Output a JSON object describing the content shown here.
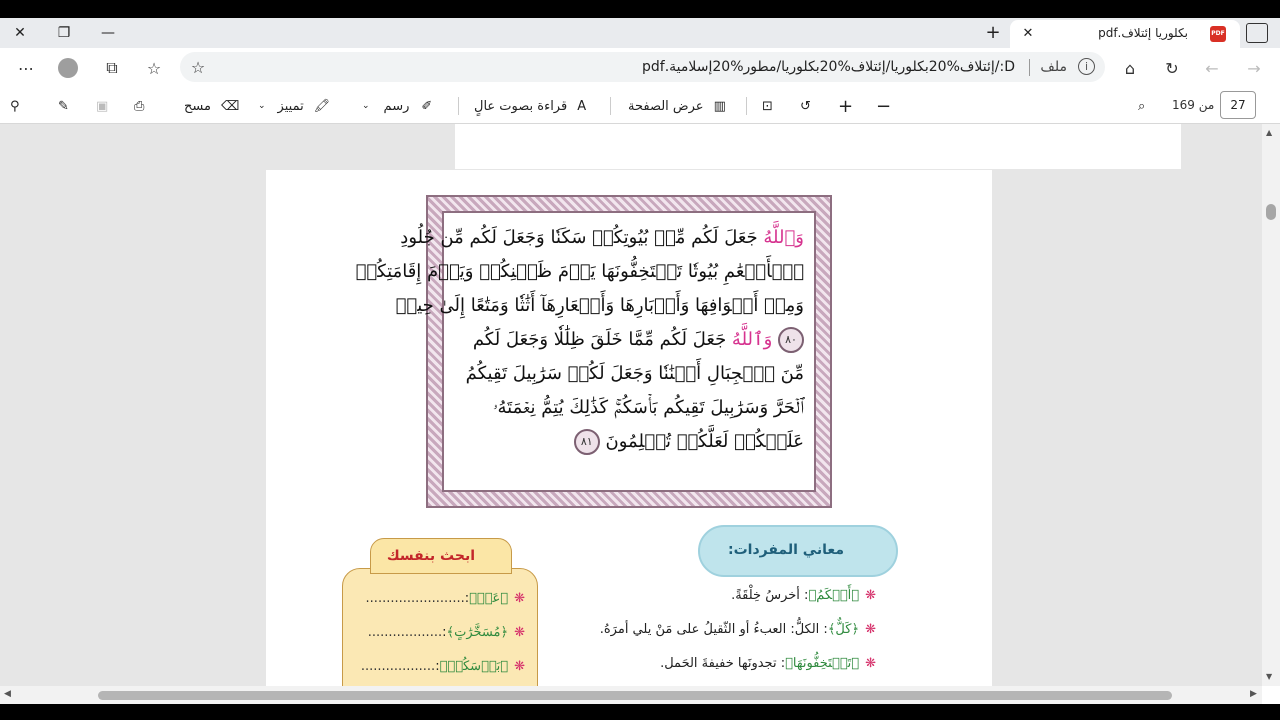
{
  "browser": {
    "tab_title": "بكلوريا إئتلاف.pdf",
    "tab_icon_label": "PDF",
    "window_close": "✕",
    "window_restore": "❐",
    "window_minimize": "—",
    "new_tab": "+",
    "tab_close": "✕"
  },
  "addressbar": {
    "file_label": "ملف",
    "url": "D:/إئتلاف%20بكلوريا/إئتلاف%20بكلوريا/مطور%20إسلامية.pdf",
    "info_glyph": "i"
  },
  "pdf_toolbar": {
    "page_number": "27",
    "page_of": "من 169",
    "page_view": "عرض الصفحة",
    "read_aloud": "قراءة بصوت عالٍ",
    "draw": "رسم",
    "highlight": "تمييز",
    "erase": "مسح"
  },
  "quran": {
    "lines": [
      {
        "pre": "",
        "divine": "وَٱللَّهُ",
        "text": " جَعَلَ لَكُم مِّنۢ بُيُوتِكُمۡ سَكَنٗا وَجَعَلَ لَكُم مِّن جُلُودِ"
      },
      {
        "pre": "",
        "divine": "",
        "text": "ٱلۡأَنۡعَٰمِ بُيُوتٗا تَسۡتَخِفُّونَهَا يَوۡمَ ظَعۡنِكُمۡ وَيَوۡمَ إِقَامَتِكُمۡ"
      },
      {
        "pre": "",
        "divine": "",
        "text": "وَمِنۡ أَصۡوَافِهَا وَأَوۡبَارِهَا وَأَشۡعَارِهَآ أَثَٰثٗا وَمَتَٰعًا إِلَىٰ حِينٖ"
      },
      {
        "pre": "٨٠",
        "divine": "وَٱللَّهُ",
        "text": " جَعَلَ لَكُم مِّمَّا خَلَقَ ظِلَٰلٗا وَجَعَلَ لَكُم"
      },
      {
        "pre": "",
        "divine": "",
        "text": "مِّنَ ٱلۡجِبَالِ أَكۡنَٰنٗا وَجَعَلَ لَكُمۡ سَرَٰبِيلَ تَقِيكُمُ"
      },
      {
        "pre": "",
        "divine": "",
        "text": "ٱلۡحَرَّ وَسَرَٰبِيلَ تَقِيكُم بَأۡسَكُمۡۚ كَذَٰلِكَ يُتِمُّ نِعۡمَتَهُۥ"
      },
      {
        "pre": "",
        "divine": "",
        "text": "عَلَيۡكُمۡ لَعَلَّكُمۡ تُسۡلِمُونَ",
        "marker": "٨١"
      }
    ]
  },
  "vocab": {
    "heading": "معاني المفردات:",
    "items": [
      {
        "word": "﴿أَنۡكَمُ﴾",
        "meaning": ": أخرسُ خِلْقَةً."
      },
      {
        "word": "﴿كَلٌّ﴾",
        "meaning": ": الكلُّ: العبءُ أو الثّقيلُ على مَنْ يلي أمرَهُ."
      },
      {
        "word": "﴿تَسۡتَخِفُّونَهَا﴾",
        "meaning": ": تجدونَها خفيفةَ الحَمل."
      }
    ]
  },
  "research": {
    "title": "ابحث بنفسك",
    "items": [
      {
        "word": "﴿عَبۡ﴾",
        "dots": "........................"
      },
      {
        "word": "﴿مُسَخَّرَٰتٍ﴾",
        "dots": ".................."
      },
      {
        "word": "﴿بَأۡسَكُمۡ﴾",
        "dots": ".................."
      }
    ]
  },
  "colors": {
    "divine_name": "#d6338f",
    "frame": "#8d6e80",
    "cloud": "#bfe4ec",
    "research_box": "#fbe8b4",
    "research_title": "#c3262a"
  }
}
